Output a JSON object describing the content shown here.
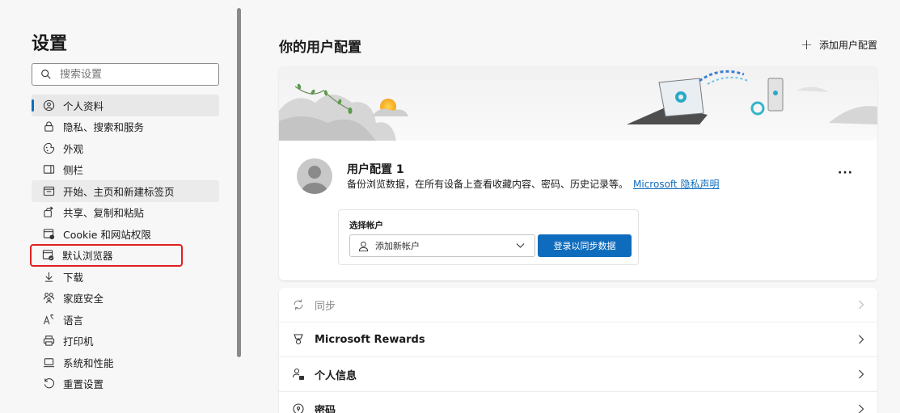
{
  "sidebar": {
    "title": "设置",
    "search_placeholder": "搜索设置",
    "items": [
      {
        "label": "个人资料",
        "icon": "profile-icon"
      },
      {
        "label": "隐私、搜索和服务",
        "icon": "lock-icon"
      },
      {
        "label": "外观",
        "icon": "appearance-icon"
      },
      {
        "label": "侧栏",
        "icon": "sidebar-icon"
      },
      {
        "label": "开始、主页和新建标签页",
        "icon": "home-icon"
      },
      {
        "label": "共享、复制和粘贴",
        "icon": "share-icon"
      },
      {
        "label": "Cookie 和网站权限",
        "icon": "cookie-icon"
      },
      {
        "label": "默认浏览器",
        "icon": "browser-icon"
      },
      {
        "label": "下载",
        "icon": "download-icon"
      },
      {
        "label": "家庭安全",
        "icon": "family-icon"
      },
      {
        "label": "语言",
        "icon": "language-icon"
      },
      {
        "label": "打印机",
        "icon": "printer-icon"
      },
      {
        "label": "系统和性能",
        "icon": "laptop-icon"
      },
      {
        "label": "重置设置",
        "icon": "reset-icon"
      }
    ]
  },
  "main": {
    "title": "你的用户配置",
    "add_profile_label": "添加用户配置",
    "profile": {
      "name": "用户配置 1",
      "description": "备份浏览数据，在所有设备上查看收藏内容、密码、历史记录等。",
      "privacy_link": "Microsoft 隐私声明",
      "more_label": "···"
    },
    "account": {
      "label": "选择帐户",
      "selected": "添加新帐户",
      "signin_button": "登录以同步数据"
    },
    "settings_list": [
      {
        "label": "同步",
        "icon": "sync-icon"
      },
      {
        "label": "Microsoft Rewards",
        "icon": "rewards-icon"
      },
      {
        "label": "个人信息",
        "icon": "personal-info-icon"
      },
      {
        "label": "密码",
        "icon": "password-icon"
      }
    ]
  },
  "colors": {
    "accent": "#0f6cbd",
    "highlight_border": "#e02020"
  }
}
